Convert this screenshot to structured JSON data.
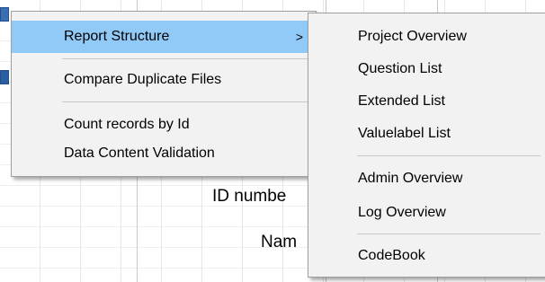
{
  "background_form": {
    "id_label": "ID numbe",
    "name_label": "Nam"
  },
  "context_menu": {
    "items": [
      {
        "label": "Report Structure",
        "has_submenu": true,
        "active": true
      },
      {
        "label": "Compare Duplicate Files"
      },
      {
        "label": "Count records by Id"
      },
      {
        "label": "Data Content Validation"
      }
    ],
    "submenu_arrow": ">"
  },
  "submenu": {
    "items": [
      {
        "label": "Project Overview"
      },
      {
        "label": "Question List"
      },
      {
        "label": "Extended List"
      },
      {
        "label": "Valuelabel List"
      },
      {
        "label": "Admin Overview"
      },
      {
        "label": "Log Overview"
      },
      {
        "label": "CodeBook"
      }
    ]
  },
  "colors": {
    "highlight": "#91c9f7",
    "menu_background": "#f2f2f2"
  }
}
